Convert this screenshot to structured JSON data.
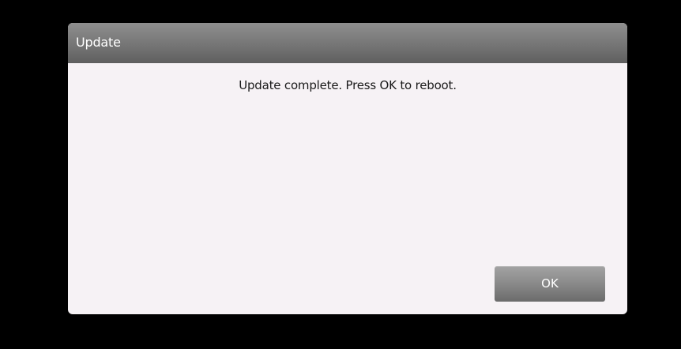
{
  "dialog": {
    "title": "Update",
    "message": "Update complete. Press OK to reboot.",
    "ok_label": "OK"
  },
  "colors": {
    "screen_background": "#000000",
    "dialog_background": "#f6f2f5",
    "titlebar_top": "#8e8e8e",
    "titlebar_bottom": "#5f5f5f",
    "button_top": "#a3a3a3",
    "button_bottom": "#6b6b6b",
    "title_text": "#ffffff",
    "message_text": "#1a1a1a"
  }
}
